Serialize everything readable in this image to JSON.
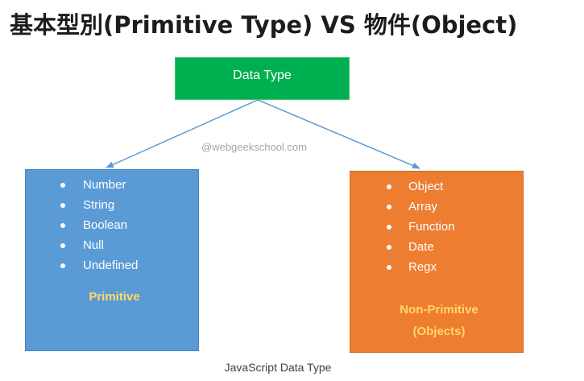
{
  "heading": "基本型別(Primitive Type) VS 物件(Object)",
  "diagram": {
    "root": {
      "label": "Data Type"
    },
    "watermark": "@webgeekschool.com",
    "primitive": {
      "items": [
        "Number",
        "String",
        "Boolean",
        "Null",
        "Undefined"
      ],
      "label": "Primitive"
    },
    "non_primitive": {
      "items": [
        "Object",
        "Array",
        "Function",
        "Date",
        "Regx"
      ],
      "label_line1": "Non-Primitive",
      "label_line2": "(Objects)"
    },
    "caption": "JavaScript Data Type",
    "colors": {
      "root": "#00b050",
      "primitive": "#5b9bd5",
      "non_primitive": "#ed7d31",
      "connector": "#5b9bd5",
      "label_accent": "#ffd966"
    }
  }
}
